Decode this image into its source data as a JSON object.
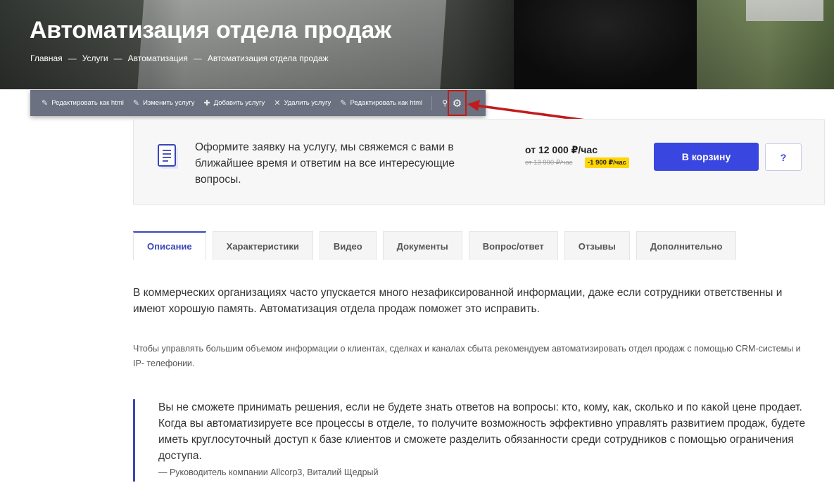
{
  "hero": {
    "title": "Автоматизация отдела продаж",
    "breadcrumb": [
      "Главная",
      "Услуги",
      "Автоматизация",
      "Автоматизация отдела продаж"
    ],
    "separator": "—"
  },
  "toolbar": {
    "items": [
      {
        "icon": "pencil-icon",
        "label": "Редактировать как html"
      },
      {
        "icon": "pencil-icon",
        "label": "Изменить услугу"
      },
      {
        "icon": "plus-icon",
        "label": "Добавить услугу"
      },
      {
        "icon": "close-icon",
        "label": "Удалить услугу"
      },
      {
        "icon": "pencil-icon",
        "label": "Редактировать как html"
      }
    ],
    "pin_icon": "pin-icon",
    "gear_icon": "gear-icon",
    "highlight_color": "#c21b1b"
  },
  "order": {
    "text": "Оформите заявку на услугу, мы свяжемся с вами в ближайшее время и ответим на все интересующие вопросы.",
    "price": "от 12 000 ₽/час",
    "old_price": "от 13 900 ₽/час",
    "discount": "-1 900 ₽/час",
    "cart_label": "В корзину",
    "question_label": "?",
    "accent": "#3a46e0"
  },
  "tabs": [
    {
      "label": "Описание",
      "active": true
    },
    {
      "label": "Характеристики",
      "active": false
    },
    {
      "label": "Видео",
      "active": false
    },
    {
      "label": "Документы",
      "active": false
    },
    {
      "label": "Вопрос/ответ",
      "active": false
    },
    {
      "label": "Отзывы",
      "active": false
    },
    {
      "label": "Дополнительно",
      "active": false
    }
  ],
  "content": {
    "para1": "В коммерческих организациях часто упускается много незафиксированной информации, даже если сотрудники ответственны и имеют хорошую память. Автоматизация отдела продаж поможет это исправить.",
    "para2": "Чтобы управлять большим объемом информации о клиентах, сделках и каналах сбыта рекомендуем автоматизировать отдел продаж с помощью CRM-системы и IP- телефонии.",
    "quote": "Вы не сможете принимать решения, если не будете знать ответов на вопросы: кто, кому, как, сколько и по какой цене продает. Когда вы автоматизируете все процессы в отделе, то получите возможность эффективно управлять развитием продаж, будете иметь круглосуточный доступ к базе клиентов и сможете разделить обязанности среди сотрудников с помощью ограничения доступа.",
    "quote_author": "— Руководитель компании Allcorp3, Виталий Щедрый"
  }
}
